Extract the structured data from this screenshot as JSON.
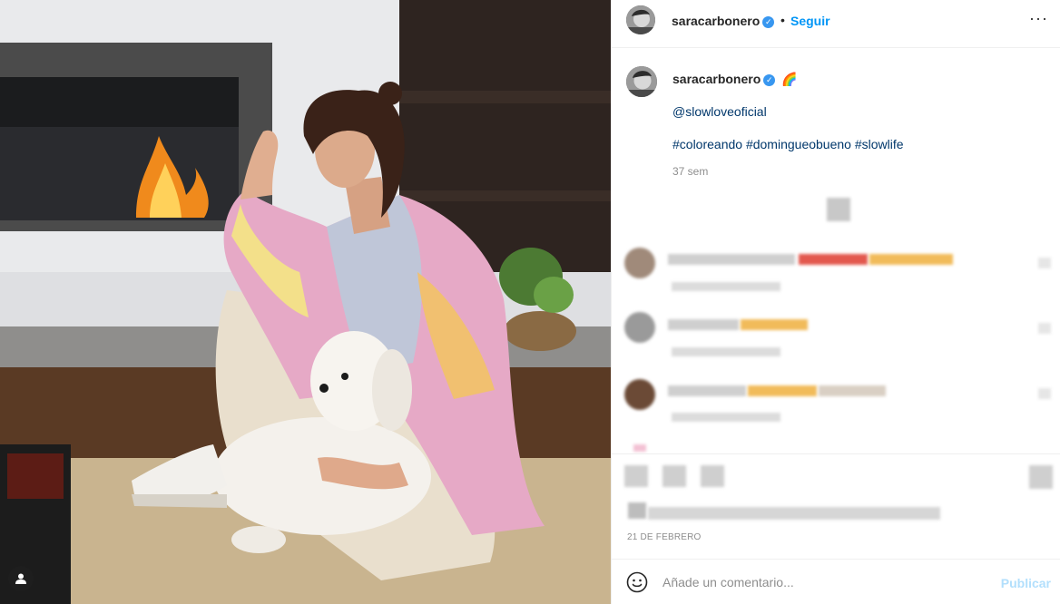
{
  "post": {
    "username": "saracarbonero",
    "verified_mark": "✓",
    "follow_label": "Seguir",
    "separator": "•",
    "more_icon": "more-options-icon",
    "more_glyph": "···"
  },
  "caption": {
    "username": "saracarbonero",
    "emoji": "🌈",
    "mention": "@slowloveoficial",
    "hashtags": "#coloreando #domingueobueno #slowlife",
    "time_ago": "37 sem"
  },
  "footer": {
    "date": "21 DE FEBRERO"
  },
  "comment_box": {
    "placeholder": "Añade un comentario...",
    "publish_label": "Publicar"
  },
  "colors": {
    "link": "#00376b",
    "follow": "#0095f6",
    "publish_disabled": "#b2dffc",
    "verified": "#3897f0",
    "muted": "#8e8e8e"
  }
}
